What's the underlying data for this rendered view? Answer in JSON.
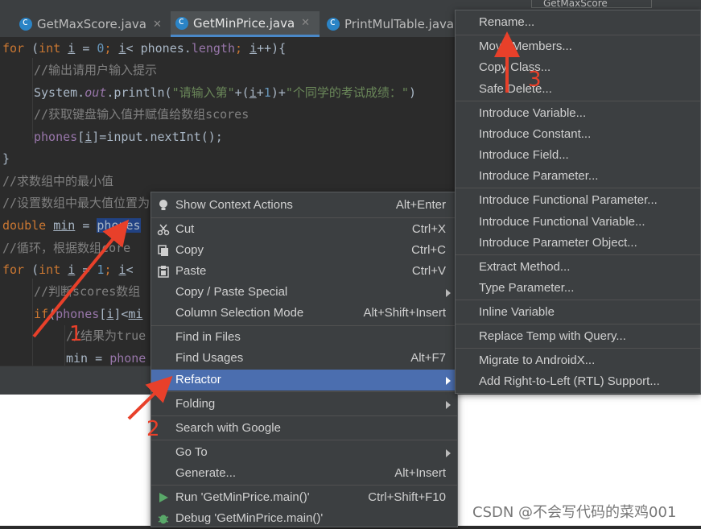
{
  "tabs": [
    {
      "label": "GetMaxScore.java",
      "active": false
    },
    {
      "label": "GetMinPrice.java",
      "active": true
    },
    {
      "label": "PrintMulTable.java",
      "active": false
    }
  ],
  "topright_label": "GetMaxScore",
  "code": {
    "l1_for": "for",
    "l1_a": " (",
    "l1_int": "int",
    "l1_b": " ",
    "l1_i": "i",
    "l1_c": " = ",
    "l1_0": "0",
    "l1_d": "; ",
    "l1_i2": "i",
    "l1_e": "< ",
    "l1_phones": "phones",
    "l1_f": ".",
    "l1_length": "length",
    "l1_g": "; ",
    "l1_i3": "i",
    "l1_h": "++){",
    "l2": "//输出请用户输入提示",
    "l3_a": "System.",
    "l3_out": "out",
    "l3_b": ".println(",
    "l3_s1": "\"请输入第\"",
    "l3_c": "+(",
    "l3_i": "i",
    "l3_d": "+",
    "l3_1": "1",
    "l3_e": ")+",
    "l3_s2": "\"个同学的考试成绩：\"",
    "l3_f": ")",
    "l4": "//获取键盘输入值并赋值给数组scores",
    "l5_phones": "phones",
    "l5_a": "[",
    "l5_i": "i",
    "l5_b": "]=input.nextInt();",
    "l6": "}",
    "l7": "//求数组中的最小值",
    "l8": "//设置数组中最大值位置为",
    "l9_double": "double",
    "l9_a": " ",
    "l9_min": "min",
    "l9_b": " = ",
    "l9_phones": "phones",
    "l10": "//循环，根据数组",
    "l10_b": "core",
    "l11_for": "for",
    "l11_a": " (",
    "l11_int": "int",
    "l11_b": " ",
    "l11_i": "i",
    "l11_c": " = ",
    "l11_1": "1",
    "l11_d": "; ",
    "l11_i2": "i",
    "l11_e": "<",
    "l12": "//判断scores数组",
    "l13_if": "if",
    "l13_a": "(",
    "l13_phones": "phones",
    "l13_b": "[",
    "l13_i": "i",
    "l13_c": "]<",
    "l13_min": "mi",
    "l14": "//结果为true",
    "l15_min": "min",
    "l15_a": " = ",
    "l15_phones": "phone"
  },
  "context_menu": {
    "items": [
      {
        "label": "Show Context Actions",
        "shortcut": "Alt+Enter",
        "icon": "bulb-icon"
      },
      {
        "label": "Cut",
        "shortcut": "Ctrl+X",
        "icon": "scissors-icon"
      },
      {
        "label": "Copy",
        "shortcut": "Ctrl+C",
        "icon": "copy-icon"
      },
      {
        "label": "Paste",
        "shortcut": "Ctrl+V",
        "icon": "paste-icon"
      },
      {
        "label": "Copy / Paste Special",
        "shortcut": ""
      },
      {
        "label": "Column Selection Mode",
        "shortcut": "Alt+Shift+Insert"
      },
      {
        "label": "Find in Files",
        "shortcut": ""
      },
      {
        "label": "Find Usages",
        "shortcut": "Alt+F7"
      },
      {
        "label": "Refactor",
        "shortcut": "",
        "selected": true
      },
      {
        "label": "Folding",
        "shortcut": ""
      },
      {
        "label": "Search with Google",
        "shortcut": ""
      },
      {
        "label": "Go To",
        "shortcut": ""
      },
      {
        "label": "Generate...",
        "shortcut": "Alt+Insert"
      },
      {
        "label": "Run 'GetMinPrice.main()'",
        "shortcut": "Ctrl+Shift+F10",
        "icon": "run-icon"
      },
      {
        "label": "Debug 'GetMinPrice.main()'",
        "shortcut": "",
        "icon": "debug-icon"
      }
    ]
  },
  "refactor_menu": {
    "items": [
      {
        "label": "Rename..."
      },
      {
        "label": "Move Members..."
      },
      {
        "label": "Copy Class..."
      },
      {
        "label": "Safe Delete..."
      },
      {
        "label": "Introduce Variable..."
      },
      {
        "label": "Introduce Constant..."
      },
      {
        "label": "Introduce Field..."
      },
      {
        "label": "Introduce Parameter..."
      },
      {
        "label": "Introduce Functional Parameter..."
      },
      {
        "label": "Introduce Functional Variable..."
      },
      {
        "label": "Introduce Parameter Object..."
      },
      {
        "label": "Extract Method..."
      },
      {
        "label": "Type Parameter..."
      },
      {
        "label": "Inline Variable"
      },
      {
        "label": "Replace Temp with Query..."
      },
      {
        "label": "Migrate to AndroidX..."
      },
      {
        "label": "Add Right-to-Left (RTL) Support..."
      }
    ]
  },
  "annotations": {
    "n1": "1",
    "n2": "2",
    "n3": "3",
    "color": "#e8402a"
  },
  "watermark": "CSDN @不会写代码的菜鸡001",
  "colors": {
    "selection": "#4b6eaf",
    "menu_bg": "#3c3f41",
    "editor_bg": "#2b2b2b",
    "keyword": "#cc7832",
    "string": "#6a8759"
  }
}
